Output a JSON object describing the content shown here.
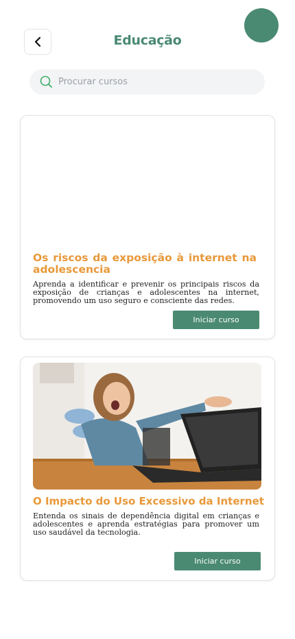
{
  "colors": {
    "primary": "#4a8a72",
    "accent_orange": "#e8993a",
    "search_icon": "#3fae6b"
  },
  "header": {
    "title": "Educação",
    "back_icon": "chevron-left-icon"
  },
  "search": {
    "placeholder": "Procurar cursos",
    "icon": "search-icon"
  },
  "courses": [
    {
      "title": "Os riscos da exposição à internet na adolescencia",
      "description": "Aprenda a identificar e prevenir os principais riscos da exposição de crianças e adolescentes na internet, promovendo um uso seguro e consciente das redes.",
      "button_label": "Iniciar curso",
      "has_image": false
    },
    {
      "title": "O Impacto do Uso Excessivo da Internet",
      "description": "Entenda os sinais de dependência digital em crianças e adolescentes e aprenda estratégias para promover um uso saudável da tecnologia.",
      "button_label": "Iniciar curso",
      "has_image": true
    }
  ]
}
